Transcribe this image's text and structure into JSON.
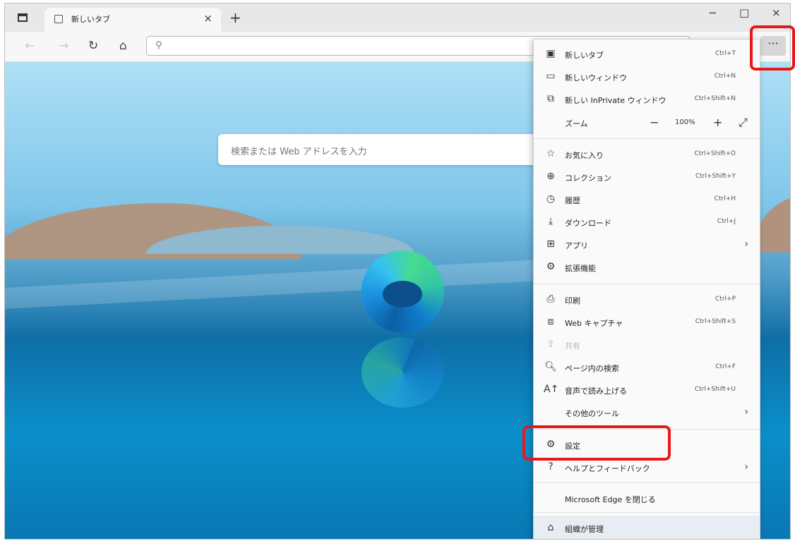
{
  "tab": {
    "title": "新しいタブ",
    "close": "×",
    "new": "+"
  },
  "window_controls": {
    "minimize": "−",
    "maximize": "□",
    "close": "×"
  },
  "toolbar": {
    "back": "←",
    "forward": "→",
    "refresh": "↻",
    "home": "⌂",
    "search_icon": "⚲",
    "more": "···"
  },
  "ntp": {
    "search_placeholder": "検索または Web アドレスを入力"
  },
  "menu": {
    "new_tab": {
      "label": "新しいタブ",
      "shortcut": "Ctrl+T"
    },
    "new_window": {
      "label": "新しいウィンドウ",
      "shortcut": "Ctrl+N"
    },
    "new_private": {
      "label": "新しい InPrivate ウィンドウ",
      "shortcut": "Ctrl+Shift+N"
    },
    "zoom": {
      "label": "ズーム",
      "minus": "−",
      "value": "100%",
      "plus": "+",
      "fullscreen": "⤢"
    },
    "favorites": {
      "label": "お気に入り",
      "shortcut": "Ctrl+Shift+O"
    },
    "collections": {
      "label": "コレクション",
      "shortcut": "Ctrl+Shift+Y"
    },
    "history": {
      "label": "履歴",
      "shortcut": "Ctrl+H"
    },
    "downloads": {
      "label": "ダウンロード",
      "shortcut": "Ctrl+J"
    },
    "apps": {
      "label": "アプリ",
      "arrow": "›"
    },
    "extensions": {
      "label": "拡張機能"
    },
    "print": {
      "label": "印刷",
      "shortcut": "Ctrl+P"
    },
    "web_capture": {
      "label": "Web キャプチャ",
      "shortcut": "Ctrl+Shift+S"
    },
    "share": {
      "label": "共有"
    },
    "find": {
      "label": "ページ内の検索",
      "shortcut": "Ctrl+F"
    },
    "read_aloud": {
      "label": "音声で読み上げる",
      "shortcut": "Ctrl+Shift+U"
    },
    "more_tools": {
      "label": "その他のツール",
      "arrow": "›"
    },
    "settings": {
      "label": "設定"
    },
    "help": {
      "label": "ヘルプとフィードバック",
      "arrow": "›"
    },
    "close_edge": {
      "label": "Microsoft Edge を閉じる"
    },
    "managed": {
      "label": "組織が管理"
    }
  }
}
